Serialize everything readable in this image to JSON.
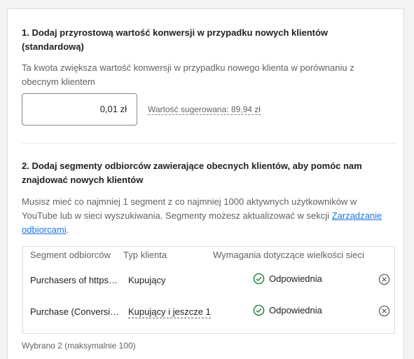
{
  "section1": {
    "title": "1. Dodaj przyrostową wartość konwersji w przypadku nowych klientów (standardową)",
    "description": "Ta kwota zwiększa wartość konwersji w przypadku nowego klienta w porównaniu z obecnym klientem",
    "value": "0,01 zł",
    "suggested": "Wartość sugerowana: 89,94 zł"
  },
  "section2": {
    "title": "2. Dodaj segmenty odbiorców zawierające obecnych klientów, aby pomóc nam znajdować nowych klientów",
    "description": "Musisz mieć co najmniej 1 segment z co najmniej 1000 aktywnych użytkowników w YouTube lub w sieci wyszukiwania. Segmenty możesz aktualizować w sekcji",
    "link": "Zarządzanie odbiorcami",
    "period": "."
  },
  "table": {
    "headers": [
      "Segment odbiorców",
      "Typ klienta",
      "Wymagania dotyczące wielkości sieci"
    ],
    "rows": [
      {
        "segment": "Purchasers of https…",
        "type": "Kupujący",
        "status": "Odpowiednia"
      },
      {
        "segment": "Purchase (Conversi…",
        "type": "Kupujący i jeszcze 1",
        "status": "Odpowiednia"
      }
    ]
  },
  "footer": "Wybrano 2 (maksymalnie 100)",
  "colors": {
    "accent": "#1a73e8",
    "success": "#188038",
    "border": "#dadce0"
  },
  "icons": [
    "check-circle-icon",
    "remove-circle-icon"
  ]
}
